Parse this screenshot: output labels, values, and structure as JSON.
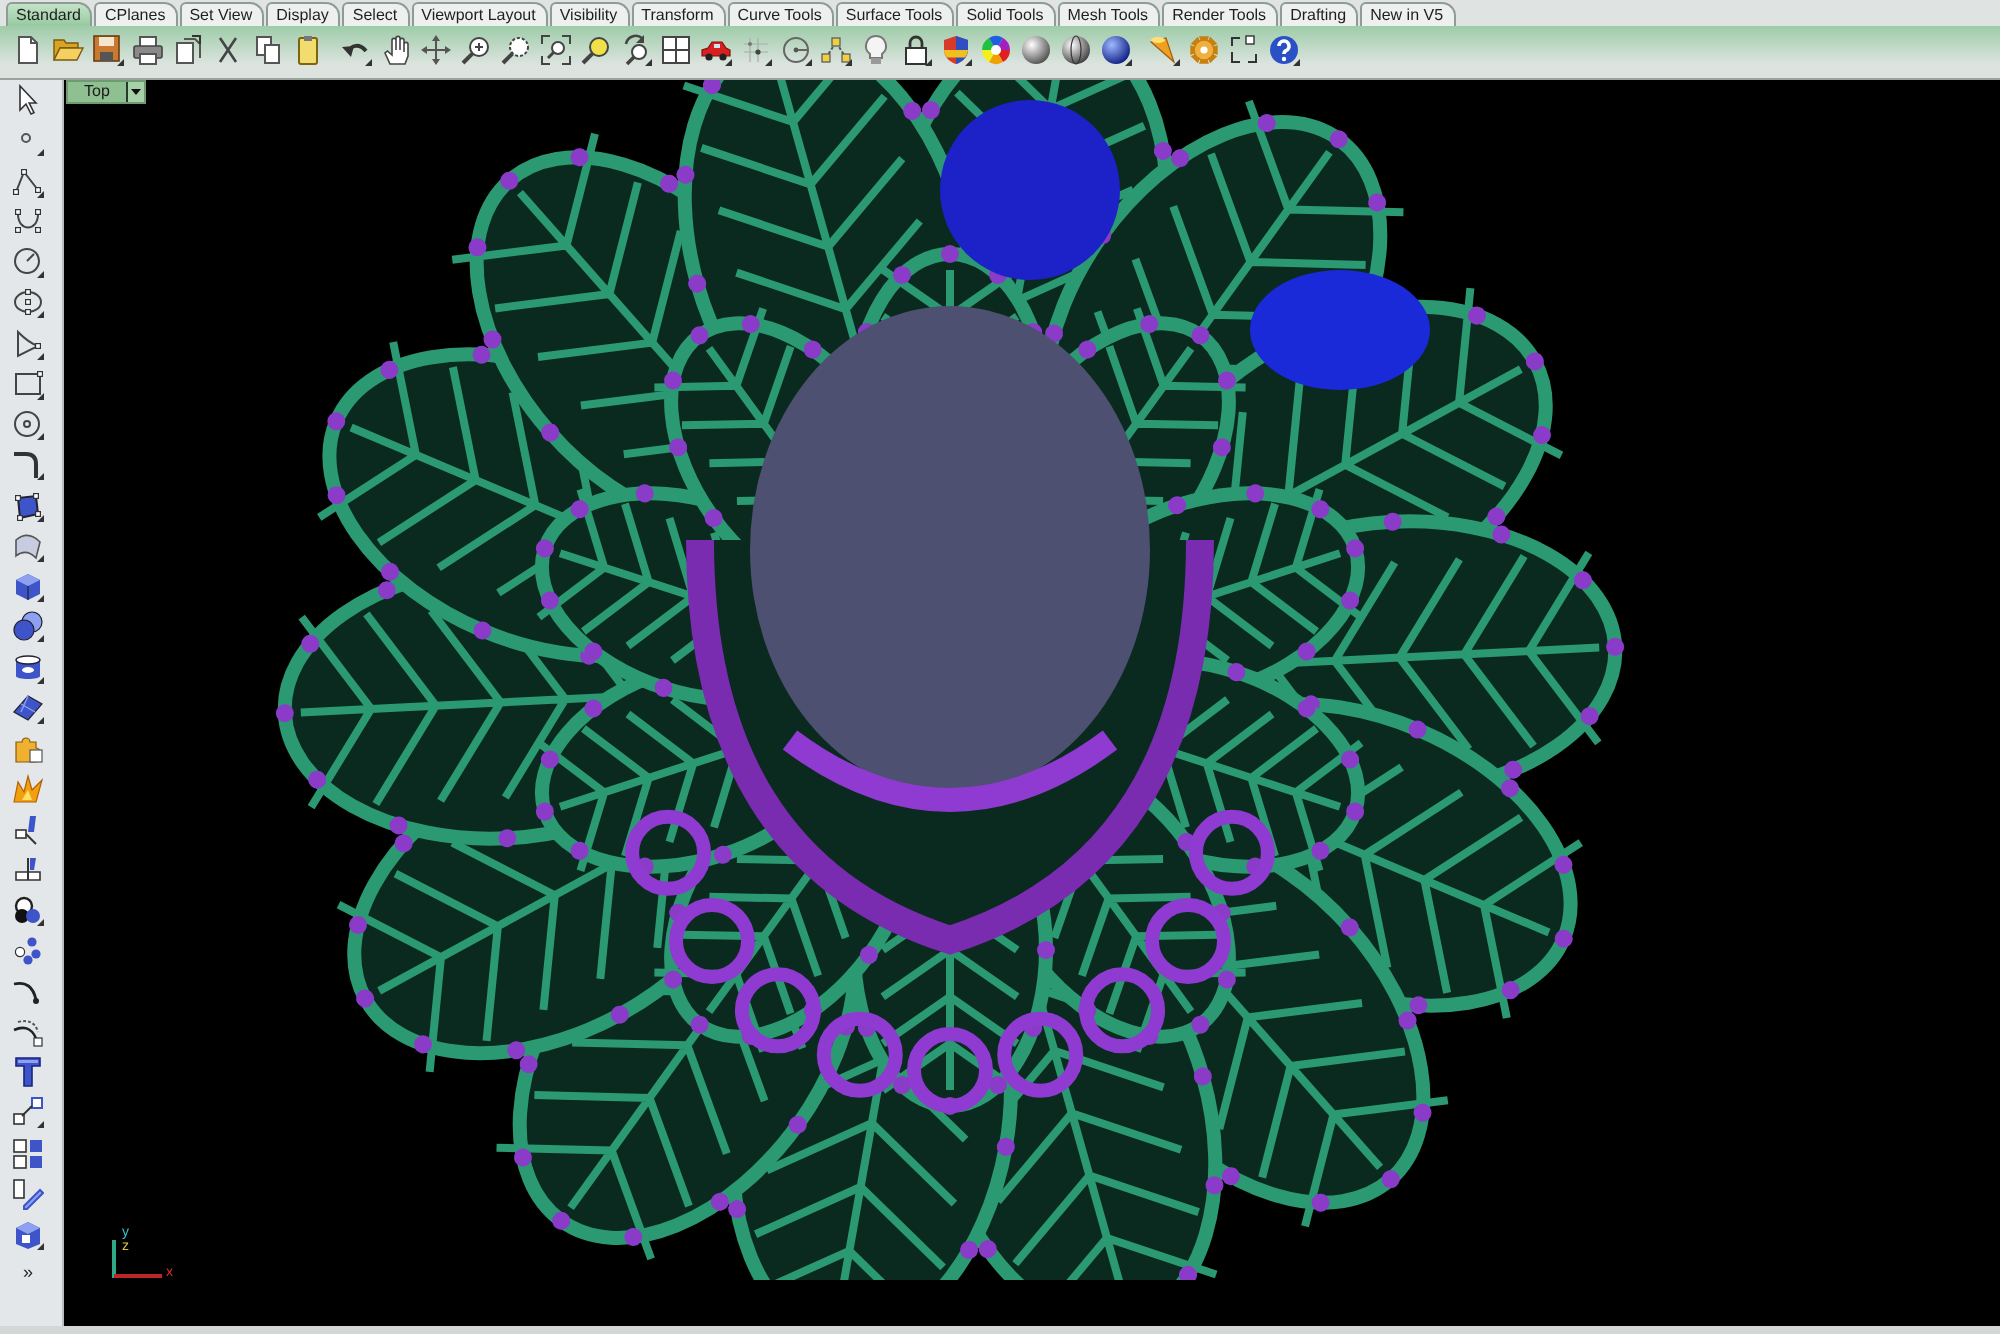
{
  "toolbar_tabs": [
    {
      "label": "Standard",
      "selected": true
    },
    {
      "label": "CPlanes",
      "selected": false
    },
    {
      "label": "Set View",
      "selected": false
    },
    {
      "label": "Display",
      "selected": false
    },
    {
      "label": "Select",
      "selected": false
    },
    {
      "label": "Viewport Layout",
      "selected": false
    },
    {
      "label": "Visibility",
      "selected": false
    },
    {
      "label": "Transform",
      "selected": false
    },
    {
      "label": "Curve Tools",
      "selected": false
    },
    {
      "label": "Surface Tools",
      "selected": false
    },
    {
      "label": "Solid Tools",
      "selected": false
    },
    {
      "label": "Mesh Tools",
      "selected": false
    },
    {
      "label": "Render Tools",
      "selected": false
    },
    {
      "label": "Drafting",
      "selected": false
    },
    {
      "label": "New in V5",
      "selected": false
    }
  ],
  "side_toolbar": {
    "overflow": "»"
  },
  "viewport": {
    "label": "Top",
    "axes": [
      {
        "label": "y",
        "color": "#3cc0c8"
      },
      {
        "label": "z",
        "color": "#d8c23a"
      },
      {
        "label": "x",
        "color": "#d83030"
      }
    ]
  }
}
